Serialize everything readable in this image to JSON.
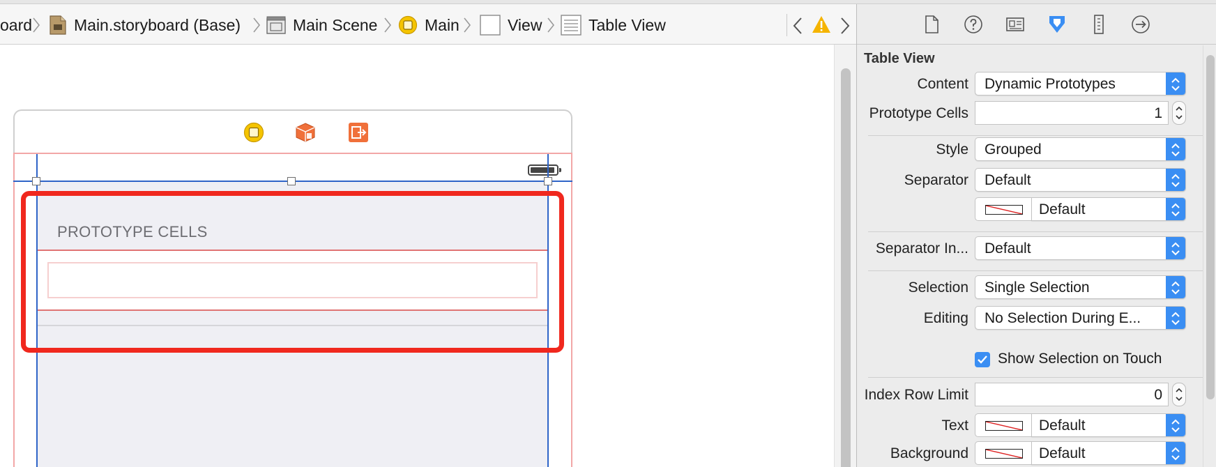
{
  "breadcrumb": {
    "items": [
      {
        "label": "oard",
        "icon": "storyboard-file-icon"
      },
      {
        "label": "Main.storyboard (Base)",
        "icon": "storyboard-file-icon"
      },
      {
        "label": "Main Scene",
        "icon": "scene-icon"
      },
      {
        "label": "Main",
        "icon": "view-controller-icon"
      },
      {
        "label": "View",
        "icon": "view-icon"
      },
      {
        "label": "Table View",
        "icon": "table-view-icon"
      }
    ]
  },
  "canvas": {
    "section_header": "PROTOTYPE CELLS"
  },
  "inspector": {
    "section_title": "Table View",
    "content": {
      "label": "Content",
      "value": "Dynamic Prototypes"
    },
    "prototype_cells": {
      "label": "Prototype Cells",
      "value": "1"
    },
    "style": {
      "label": "Style",
      "value": "Grouped"
    },
    "separator": {
      "label": "Separator",
      "value": "Default"
    },
    "separator_color": {
      "value": "Default"
    },
    "separator_inset": {
      "label": "Separator In...",
      "value": "Default"
    },
    "selection": {
      "label": "Selection",
      "value": "Single Selection"
    },
    "editing": {
      "label": "Editing",
      "value": "No Selection During E..."
    },
    "show_selection": {
      "label": "Show Selection on Touch",
      "checked": true
    },
    "index_row_limit": {
      "label": "Index Row Limit",
      "value": "0"
    },
    "text": {
      "label": "Text",
      "value": "Default"
    },
    "background": {
      "label": "Background",
      "value": "Default"
    }
  },
  "colors": {
    "accent": "#3a8ef3",
    "highlight": "#f0281e",
    "guide": "#2f64c8",
    "warning": "#f5b400"
  }
}
